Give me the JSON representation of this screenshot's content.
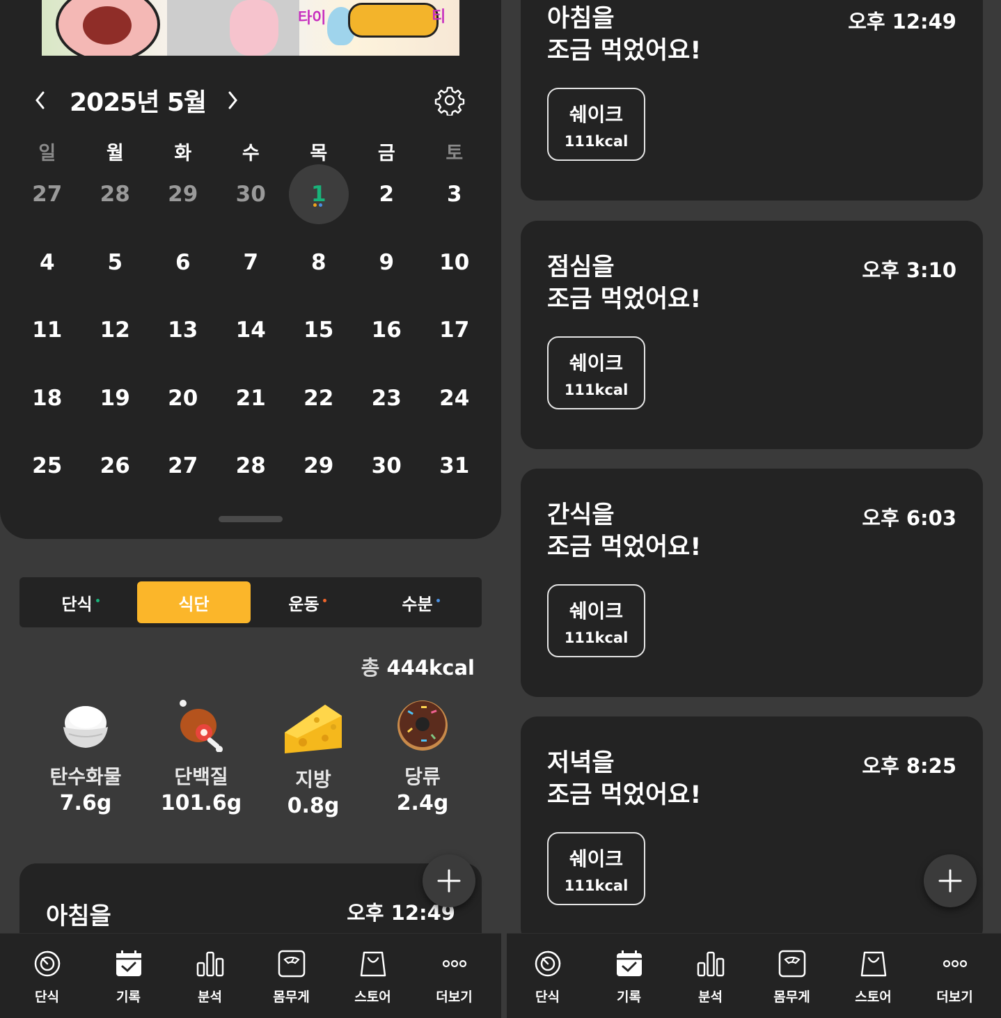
{
  "banner": {
    "text_left": "타이",
    "text_right": "티"
  },
  "calendar": {
    "month_label": "2025년 5월",
    "weekdays": [
      "일",
      "월",
      "화",
      "수",
      "목",
      "금",
      "토"
    ],
    "weeks": [
      [
        "27",
        "28",
        "29",
        "30",
        "1",
        "2",
        "3"
      ],
      [
        "4",
        "5",
        "6",
        "7",
        "8",
        "9",
        "10"
      ],
      [
        "11",
        "12",
        "13",
        "14",
        "15",
        "16",
        "17"
      ],
      [
        "18",
        "19",
        "20",
        "21",
        "22",
        "23",
        "24"
      ],
      [
        "25",
        "26",
        "27",
        "28",
        "29",
        "30",
        "31"
      ]
    ],
    "today": "1",
    "today_dot_colors": [
      "#f0a31c",
      "#4a90e2"
    ]
  },
  "tabs": [
    {
      "label": "단식",
      "dot": "#19b37a",
      "active": false
    },
    {
      "label": "식단",
      "dot": "",
      "active": true
    },
    {
      "label": "운동",
      "dot": "#f0652a",
      "active": false
    },
    {
      "label": "수분",
      "dot": "#4a90e2",
      "active": false
    }
  ],
  "total": {
    "prefix": "총",
    "value": "444kcal"
  },
  "nutrients": [
    {
      "icon": "rice-bowl-icon",
      "label": "탄수화물",
      "value": "7.6g"
    },
    {
      "icon": "meat-icon",
      "label": "단백질",
      "value": "101.6g"
    },
    {
      "icon": "cheese-icon",
      "label": "지방",
      "value": "0.8g"
    },
    {
      "icon": "donut-icon",
      "label": "당류",
      "value": "2.4g"
    }
  ],
  "left_meal_peek": {
    "title": "아침을",
    "time": "오후 12:49"
  },
  "meals": [
    {
      "title_line1": "아침을",
      "title_line2": "조금 먹었어요!",
      "time": "오후 12:49",
      "food": "쉐이크",
      "kcal": "111kcal"
    },
    {
      "title_line1": "점심을",
      "title_line2": "조금 먹었어요!",
      "time": "오후 3:10",
      "food": "쉐이크",
      "kcal": "111kcal"
    },
    {
      "title_line1": "간식을",
      "title_line2": "조금 먹었어요!",
      "time": "오후 6:03",
      "food": "쉐이크",
      "kcal": "111kcal"
    },
    {
      "title_line1": "저녁을",
      "title_line2": "조금 먹었어요!",
      "time": "오후 8:25",
      "food": "쉐이크",
      "kcal": "111kcal"
    }
  ],
  "nav": [
    {
      "icon": "timer-icon",
      "label": "단식"
    },
    {
      "icon": "calendar-check-icon",
      "label": "기록"
    },
    {
      "icon": "bar-chart-icon",
      "label": "분석"
    },
    {
      "icon": "scale-icon",
      "label": "몸무게"
    },
    {
      "icon": "shopping-bag-icon",
      "label": "스토어"
    },
    {
      "icon": "more-icon",
      "label": "더보기"
    }
  ]
}
